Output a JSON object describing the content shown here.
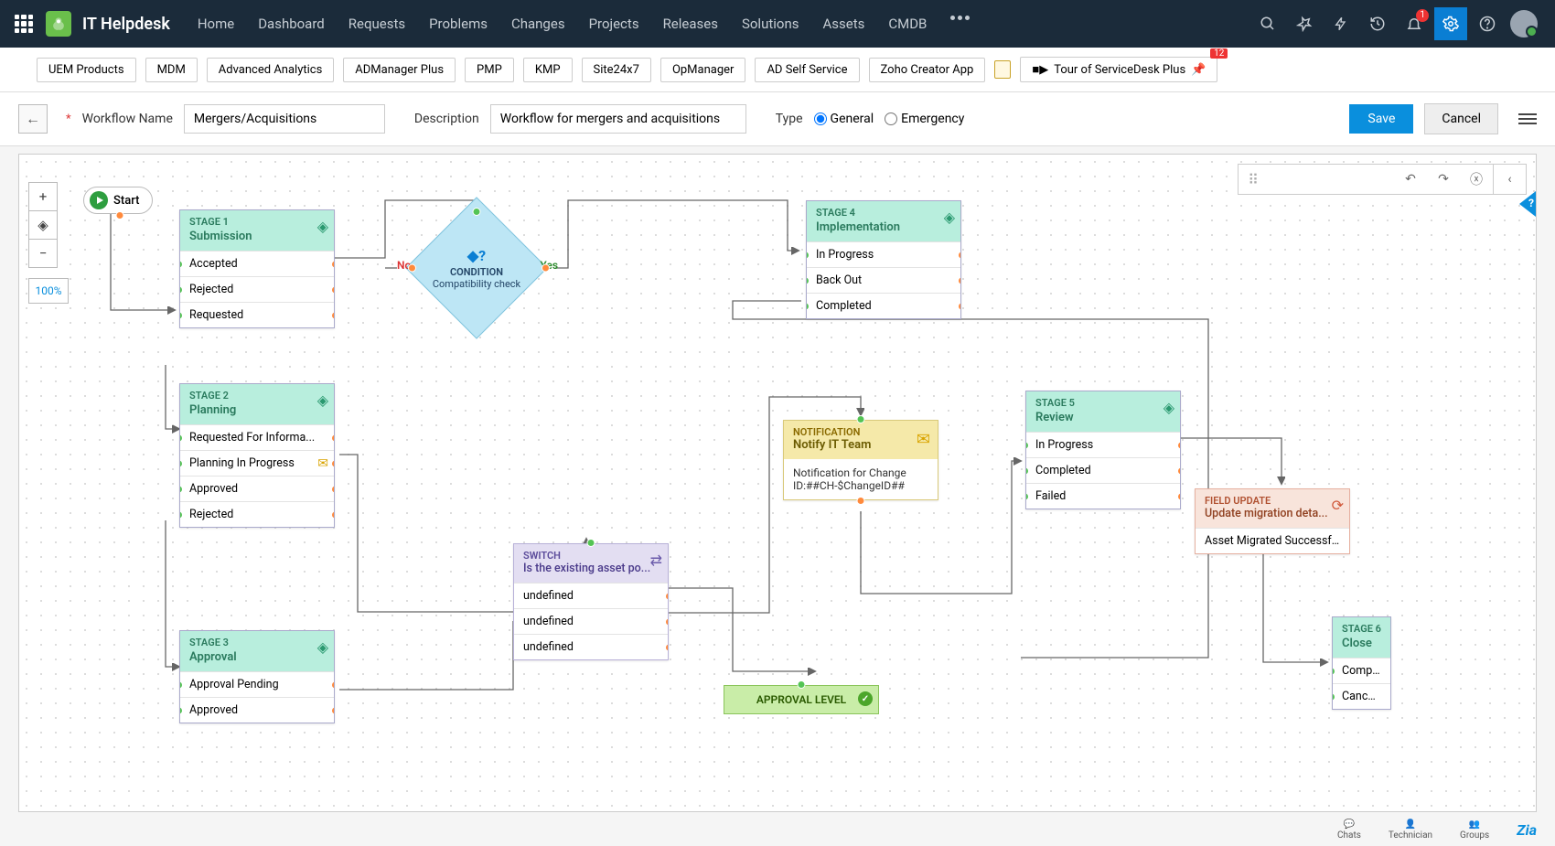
{
  "topnav": {
    "brand": "IT Helpdesk",
    "menu": [
      "Home",
      "Dashboard",
      "Requests",
      "Problems",
      "Changes",
      "Projects",
      "Releases",
      "Solutions",
      "Assets",
      "CMDB"
    ],
    "bell_badge": "1"
  },
  "shortcuts": {
    "items": [
      "UEM Products",
      "MDM",
      "Advanced Analytics",
      "ADManager Plus",
      "PMP",
      "KMP",
      "Site24x7",
      "OpManager",
      "AD Self Service",
      "Zoho Creator App"
    ],
    "tour": "Tour of ServiceDesk Plus",
    "tour_badge": "12"
  },
  "formbar": {
    "name_label": "Workflow Name",
    "name_value": "Mergers/Acquisitions",
    "desc_label": "Description",
    "desc_value": "Workflow for mergers and acquisitions",
    "type_label": "Type",
    "type_general": "General",
    "type_emergency": "Emergency",
    "save": "Save",
    "cancel": "Cancel"
  },
  "zoom": {
    "percent": "100%"
  },
  "start": {
    "label": "Start"
  },
  "stage1": {
    "title": "STAGE 1",
    "name": "Submission",
    "items": [
      "Accepted",
      "Rejected",
      "Requested"
    ]
  },
  "stage2": {
    "title": "STAGE 2",
    "name": "Planning",
    "items": [
      "Requested For Informa...",
      "Planning In Progress",
      "Approved",
      "Rejected"
    ]
  },
  "stage3": {
    "title": "STAGE 3",
    "name": "Approval",
    "items": [
      "Approval Pending",
      "Approved"
    ]
  },
  "stage4": {
    "title": "STAGE 4",
    "name": "Implementation",
    "items": [
      "In Progress",
      "Back Out",
      "Completed"
    ]
  },
  "stage5": {
    "title": "STAGE 5",
    "name": "Review",
    "items": [
      "In Progress",
      "Completed",
      "Failed"
    ]
  },
  "stage6": {
    "title": "STAGE 6",
    "name": "Close",
    "items": [
      "Completed",
      "Canceled"
    ]
  },
  "condition": {
    "type": "CONDITION",
    "text": "Compatibility check",
    "no": "No",
    "yes": "Yes"
  },
  "switch": {
    "type": "SWITCH",
    "text": "Is the existing asset po...",
    "items": [
      "undefined",
      "undefined",
      "undefined"
    ]
  },
  "notif": {
    "type": "NOTIFICATION",
    "name": "Notify IT Team",
    "body1": "Notification for Change",
    "body2": "ID:##CH-$ChangeID##"
  },
  "fieldupd": {
    "type": "FIELD UPDATE",
    "name": "Update migration deta...",
    "item": "Asset Migrated Successfu..."
  },
  "approvallevel": {
    "text": "APPROVAL LEVEL"
  },
  "footer": {
    "chats": "Chats",
    "tech": "Technician",
    "groups": "Groups"
  }
}
